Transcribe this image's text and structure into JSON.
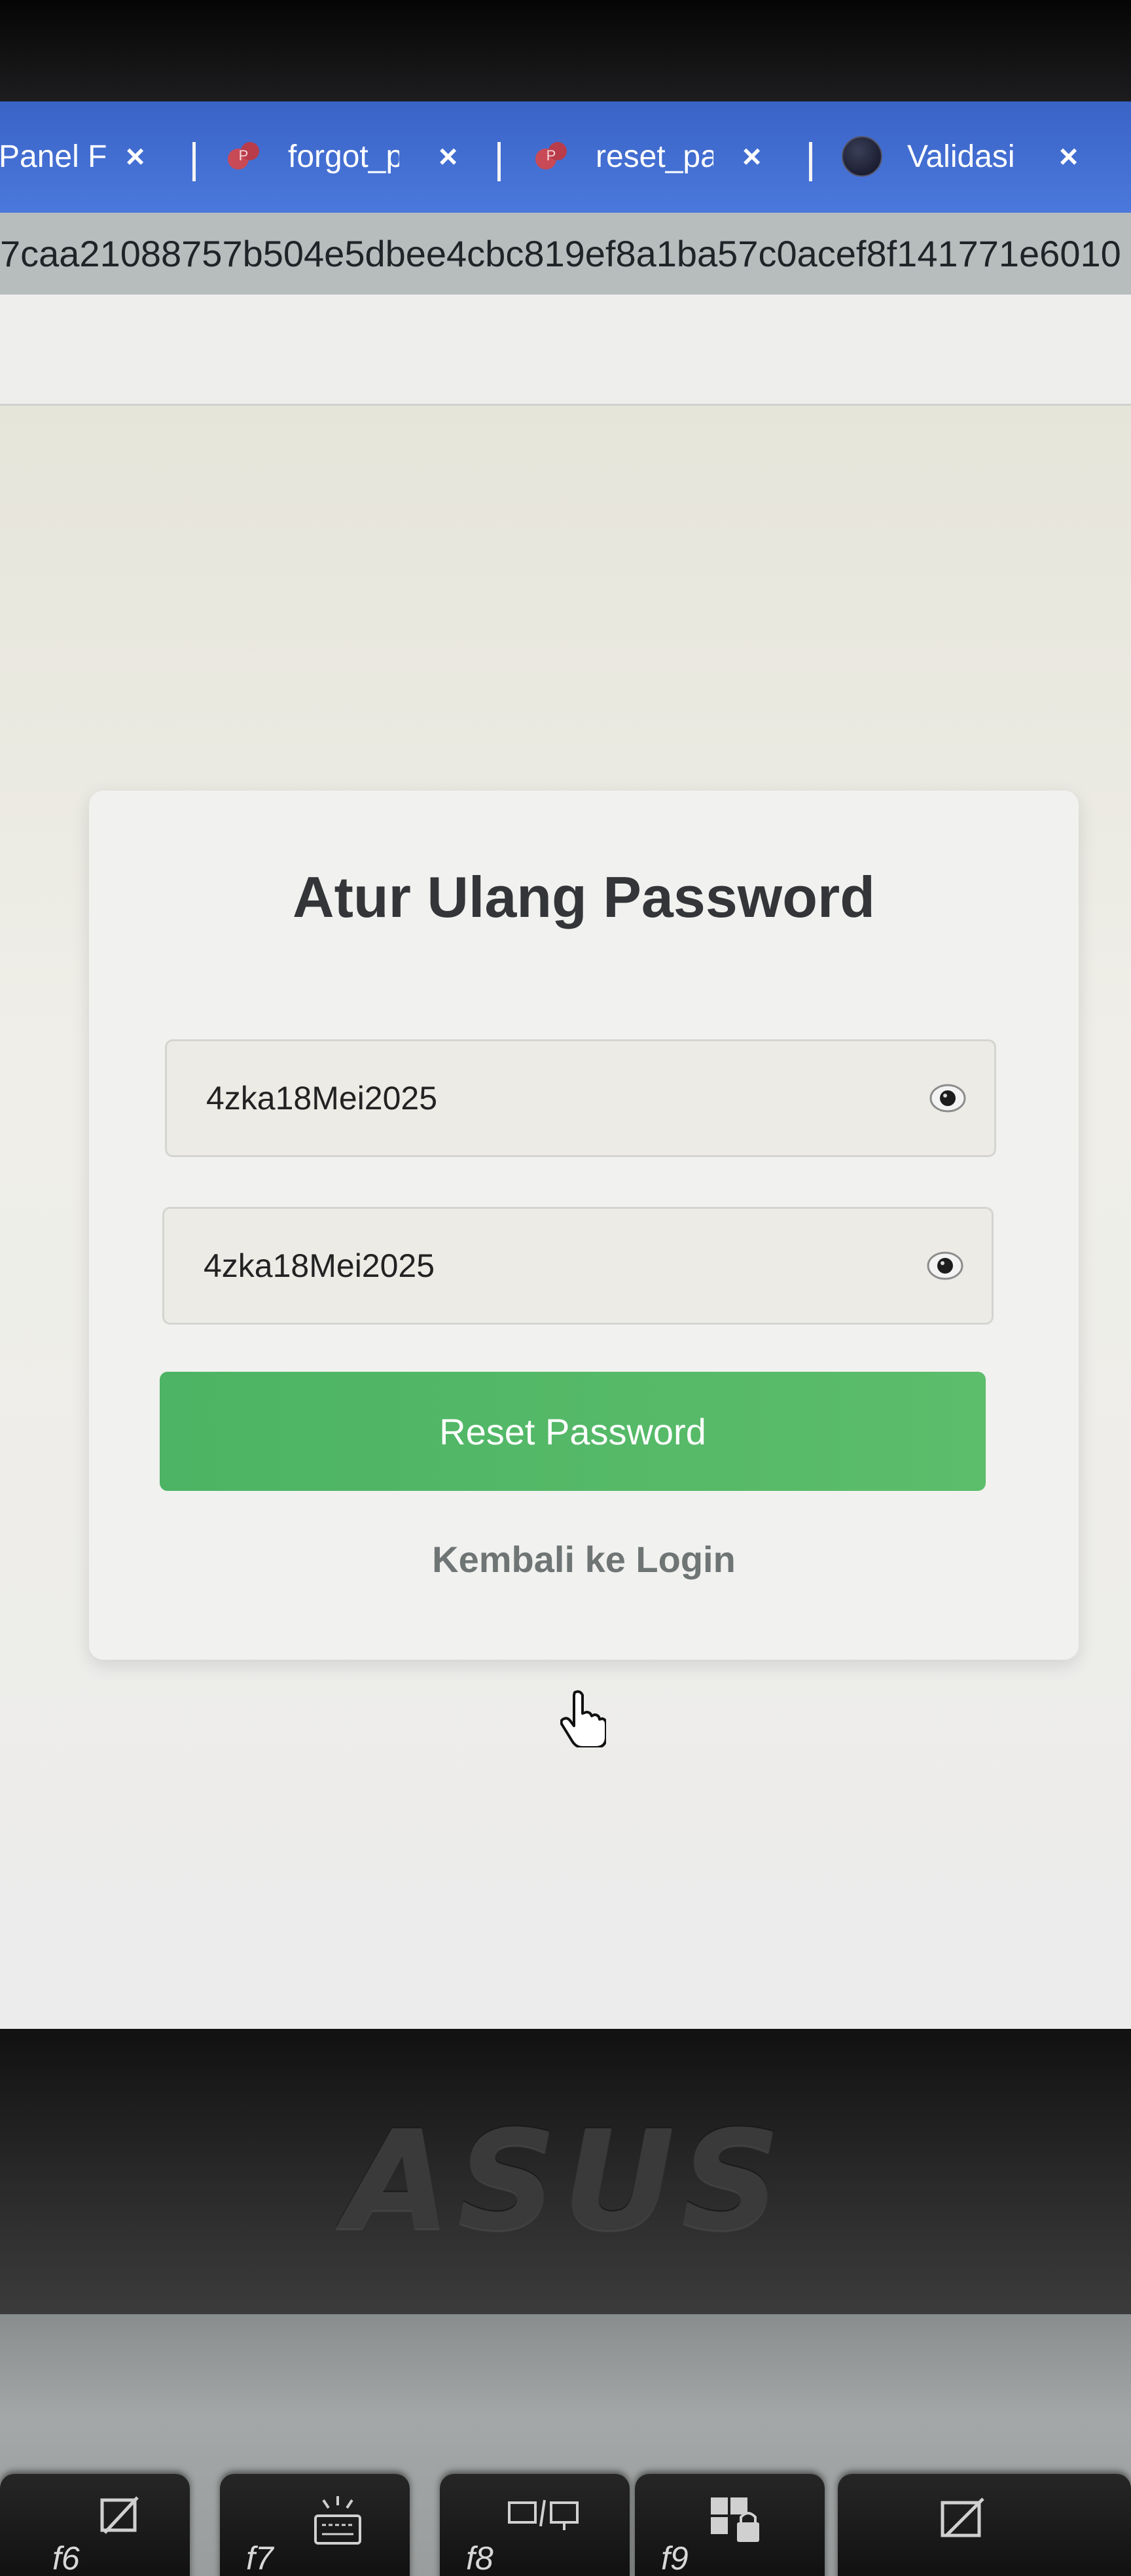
{
  "browser": {
    "tabs": [
      {
        "label": "Panel F",
        "close": "×"
      },
      {
        "label": "forgot_p",
        "close": "×"
      },
      {
        "label": "reset_pa",
        "close": "×"
      },
      {
        "label": "Validasi",
        "close": "×"
      }
    ],
    "url": "7caa21088757b504e5dbee4cbc819ef8a1ba57c0acef8f141771e6010"
  },
  "form": {
    "title": "Atur Ulang Password",
    "new_password": "4zka18Mei2025",
    "confirm_password": "4zka18Mei2025",
    "reset_button": "Reset Password",
    "back_link": "Kembali ke Login"
  },
  "hardware": {
    "brand": "ASUS",
    "keys": [
      {
        "label": "f6"
      },
      {
        "label": "f7"
      },
      {
        "label": "f8"
      },
      {
        "label": "f9"
      }
    ]
  },
  "colors": {
    "tab_bar": "#3f6bd0",
    "button": "#52b866",
    "title_text": "#333538",
    "link_text": "#6f7575"
  }
}
